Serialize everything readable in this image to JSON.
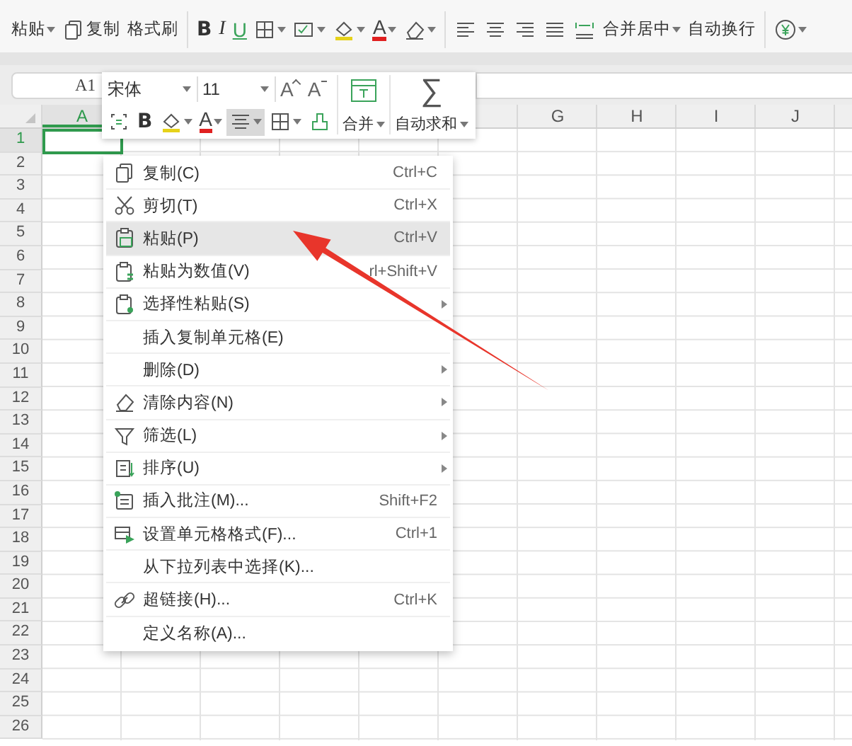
{
  "ribbon": {
    "items": [
      {
        "kind": "text",
        "label": "粘贴",
        "caret": true
      },
      {
        "kind": "copy",
        "label": "复制",
        "caret": false
      },
      {
        "kind": "text",
        "label": "格式刷",
        "caret": false
      },
      {
        "kind": "separator"
      },
      {
        "kind": "bold",
        "label": "B",
        "caret": false
      },
      {
        "kind": "italic",
        "label": "I",
        "caret": false
      },
      {
        "kind": "underline",
        "label": "U",
        "caret": false
      },
      {
        "kind": "border",
        "caret": true
      },
      {
        "kind": "cell-style",
        "caret": true
      },
      {
        "kind": "fill",
        "caret": true
      },
      {
        "kind": "font-color",
        "label": "A",
        "caret": true
      },
      {
        "kind": "eraser",
        "caret": true
      },
      {
        "kind": "separator"
      },
      {
        "kind": "align-left",
        "caret": false
      },
      {
        "kind": "align-center",
        "caret": false
      },
      {
        "kind": "align-right",
        "caret": false
      },
      {
        "kind": "justify",
        "caret": false
      },
      {
        "kind": "distribute",
        "caret": false
      },
      {
        "kind": "text",
        "label": "合并居中",
        "caret": true
      },
      {
        "kind": "text",
        "label": "自动换行",
        "caret": false
      },
      {
        "kind": "separator"
      },
      {
        "kind": "currency",
        "caret": true
      }
    ]
  },
  "formula_bar": {
    "name_box": "A1"
  },
  "mini_toolbar": {
    "font": "宋体",
    "size": "11",
    "sizers": [
      {
        "kind": "grow",
        "label": "A"
      },
      {
        "kind": "shrink",
        "label": "A"
      }
    ],
    "tools": [
      {
        "kind": "fit",
        "caret": false,
        "pressed": false
      },
      {
        "kind": "bold",
        "label": "B",
        "caret": false,
        "pressed": false
      },
      {
        "kind": "fill",
        "caret": true,
        "pressed": false
      },
      {
        "kind": "font-color",
        "label": "A",
        "caret": true,
        "pressed": false
      },
      {
        "kind": "align-center",
        "caret": true,
        "pressed": true
      },
      {
        "kind": "border",
        "caret": true,
        "pressed": false
      },
      {
        "kind": "brush",
        "caret": false,
        "pressed": false
      }
    ],
    "big_buttons": [
      {
        "kind": "merge",
        "label": "合并",
        "caret": true
      },
      {
        "kind": "sum",
        "symbol": "∑",
        "label": "自动求和",
        "caret": true
      }
    ]
  },
  "sheet": {
    "columns": [
      {
        "label": "A",
        "selected": true
      },
      {
        "label": "G",
        "selected": false
      },
      {
        "label": "H",
        "selected": false
      },
      {
        "label": "I",
        "selected": false
      },
      {
        "label": "J",
        "selected": false
      }
    ],
    "rows": [
      {
        "label": "1",
        "selected": true
      },
      {
        "label": "2",
        "selected": false
      },
      {
        "label": "3",
        "selected": false
      },
      {
        "label": "4",
        "selected": false
      },
      {
        "label": "5",
        "selected": false
      },
      {
        "label": "6",
        "selected": false
      },
      {
        "label": "7",
        "selected": false
      },
      {
        "label": "8",
        "selected": false
      },
      {
        "label": "9",
        "selected": false
      },
      {
        "label": "10",
        "selected": false
      },
      {
        "label": "11",
        "selected": false
      },
      {
        "label": "12",
        "selected": false
      },
      {
        "label": "13",
        "selected": false
      },
      {
        "label": "14",
        "selected": false
      },
      {
        "label": "15",
        "selected": false
      },
      {
        "label": "16",
        "selected": false
      },
      {
        "label": "17",
        "selected": false
      },
      {
        "label": "18",
        "selected": false
      },
      {
        "label": "19",
        "selected": false
      },
      {
        "label": "20",
        "selected": false
      },
      {
        "label": "21",
        "selected": false
      },
      {
        "label": "22",
        "selected": false
      },
      {
        "label": "23",
        "selected": false
      },
      {
        "label": "24",
        "selected": false
      },
      {
        "label": "25",
        "selected": false
      },
      {
        "label": "26",
        "selected": false
      }
    ]
  },
  "context_menu": {
    "items": [
      {
        "kind": "copy",
        "label": "复制(C)",
        "shortcut": "Ctrl+C",
        "submenu": false,
        "selected": false
      },
      {
        "kind": "scissors",
        "label": "剪切(T)",
        "shortcut": "Ctrl+X",
        "submenu": false,
        "selected": false
      },
      {
        "kind": "paste",
        "label": "粘贴(P)",
        "shortcut": "Ctrl+V",
        "submenu": false,
        "selected": true
      },
      {
        "kind": "paste-values",
        "label": "粘贴为数值(V)",
        "shortcut": "rl+Shift+V",
        "submenu": false,
        "selected": false
      },
      {
        "kind": "paste-special",
        "label": "选择性粘贴(S)",
        "submenu": true,
        "selected": false
      },
      {
        "kind": "plain",
        "label": "插入复制单元格(E)",
        "submenu": false,
        "selected": false
      },
      {
        "kind": "plain",
        "label": "删除(D)",
        "submenu": true,
        "selected": false
      },
      {
        "kind": "eraser",
        "label": "清除内容(N)",
        "submenu": true,
        "selected": false
      },
      {
        "kind": "filter",
        "label": "筛选(L)",
        "submenu": true,
        "selected": false
      },
      {
        "kind": "sort",
        "label": "排序(U)",
        "submenu": true,
        "selected": false
      },
      {
        "kind": "comment",
        "label": "插入批注(M)...",
        "shortcut": "Shift+F2",
        "submenu": false,
        "selected": false
      },
      {
        "kind": "format-cells",
        "label": "设置单元格格式(F)...",
        "shortcut": "Ctrl+1",
        "submenu": false,
        "selected": false
      },
      {
        "kind": "plain",
        "label": "从下拉列表中选择(K)...",
        "submenu": false,
        "selected": false
      },
      {
        "kind": "link",
        "label": "超链接(H)...",
        "shortcut": "Ctrl+K",
        "submenu": false,
        "selected": false
      },
      {
        "kind": "plain",
        "label": "定义名称(A)...",
        "submenu": false,
        "selected": false
      }
    ]
  },
  "annotations": [
    {
      "kind": "arrow"
    }
  ]
}
